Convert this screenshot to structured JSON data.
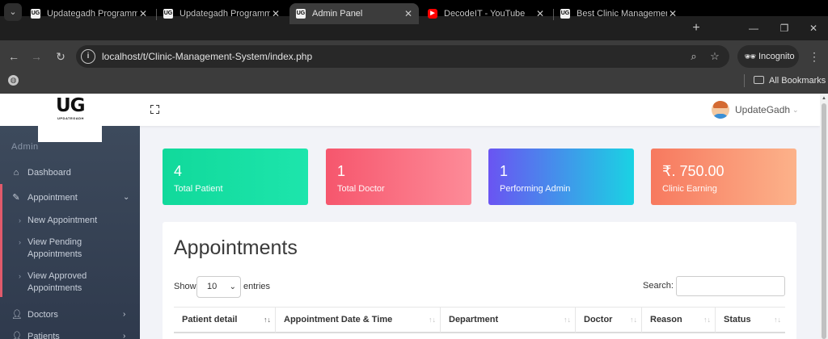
{
  "browser": {
    "tabs": [
      {
        "favicon": "UG",
        "title": "Updategadh Programming",
        "active": false
      },
      {
        "favicon": "UG",
        "title": "Updategadh Programming",
        "active": false
      },
      {
        "favicon": "UG",
        "title": "Admin Panel",
        "active": true
      },
      {
        "favicon": "youtube-icon",
        "title": "DecodeIT - YouTube",
        "active": false
      },
      {
        "favicon": "UG",
        "title": "Best Clinic Management",
        "active": false
      }
    ],
    "url": "localhost/t/Clinic-Management-System/index.php",
    "incognito_label": "Incognito",
    "bookmarks_label": "All Bookmarks"
  },
  "header": {
    "logo_text": "UG",
    "logo_sub": "UPDATEGADH",
    "username": "UpdateGadh"
  },
  "sidebar": {
    "section_title": "Admin",
    "items": [
      {
        "label": "Dashboard",
        "icon": "home-icon"
      },
      {
        "label": "Appointment",
        "icon": "edit-icon"
      },
      {
        "label": "Doctors",
        "icon": "user-icon"
      },
      {
        "label": "Patients",
        "icon": "user-icon"
      }
    ],
    "appointment_subitems": [
      {
        "label": "New Appointment"
      },
      {
        "label": "View Pending Appointments"
      },
      {
        "label": "View Approved Appointments"
      }
    ]
  },
  "stats": [
    {
      "value": "4",
      "caption": "Total Patient",
      "from": "#11d99b",
      "to": "#1de5ac"
    },
    {
      "value": "1",
      "caption": "Total Doctor",
      "from": "#f6566d",
      "to": "#fd8b98"
    },
    {
      "value": "1",
      "caption": "Performing Admin",
      "from": "#6a54f2",
      "to": "#1ad3e3"
    },
    {
      "value": "₹. 750.00",
      "caption": "Clinic Earning",
      "from": "#f7795f",
      "to": "#fcb28a"
    }
  ],
  "appointments": {
    "title": "Appointments",
    "show_label": "Show",
    "entries_value": "10",
    "entries_label": "entries",
    "search_label": "Search:",
    "columns": [
      "Patient detail",
      "Appointment Date & Time",
      "Department",
      "Doctor",
      "Reason",
      "Status"
    ]
  }
}
